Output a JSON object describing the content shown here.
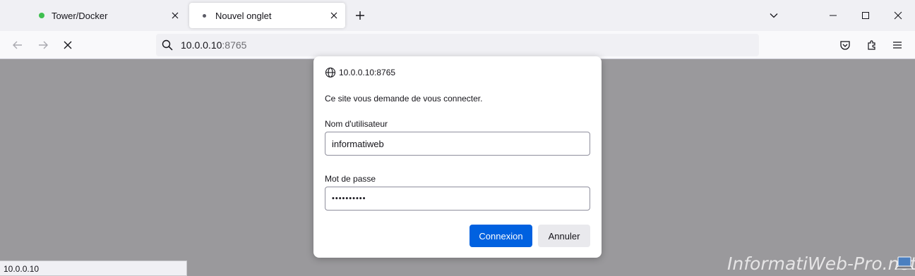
{
  "tabs": [
    {
      "label": "Tower/Docker",
      "dot_color": "#3fbf4f",
      "active": false
    },
    {
      "label": "Nouvel onglet",
      "dot_color": "#5b5b66",
      "active": true
    }
  ],
  "address_bar": {
    "host": "10.0.0.10",
    "port": ":8765"
  },
  "status_bar": {
    "text": "10.0.0.10"
  },
  "dialog": {
    "origin": "10.0.0.10:8765",
    "message": "Ce site vous demande de vous connecter.",
    "username_label": "Nom d'utilisateur",
    "username_value": "informatiweb",
    "password_label": "Mot de passe",
    "password_value": "••••••••••",
    "login_button": "Connexion",
    "cancel_button": "Annuler"
  },
  "watermark": {
    "text": "InformatiWeb-Pro.net"
  },
  "colors": {
    "accent": "#0061e0",
    "tab_green": "#3fbf4f"
  },
  "icons": [
    "close-icon",
    "plus-icon",
    "chevron-down-icon",
    "minimize-icon",
    "maximize-icon",
    "back-arrow-icon",
    "forward-arrow-icon",
    "stop-icon",
    "search-icon",
    "pocket-icon",
    "extensions-icon",
    "menu-icon",
    "globe-icon"
  ]
}
